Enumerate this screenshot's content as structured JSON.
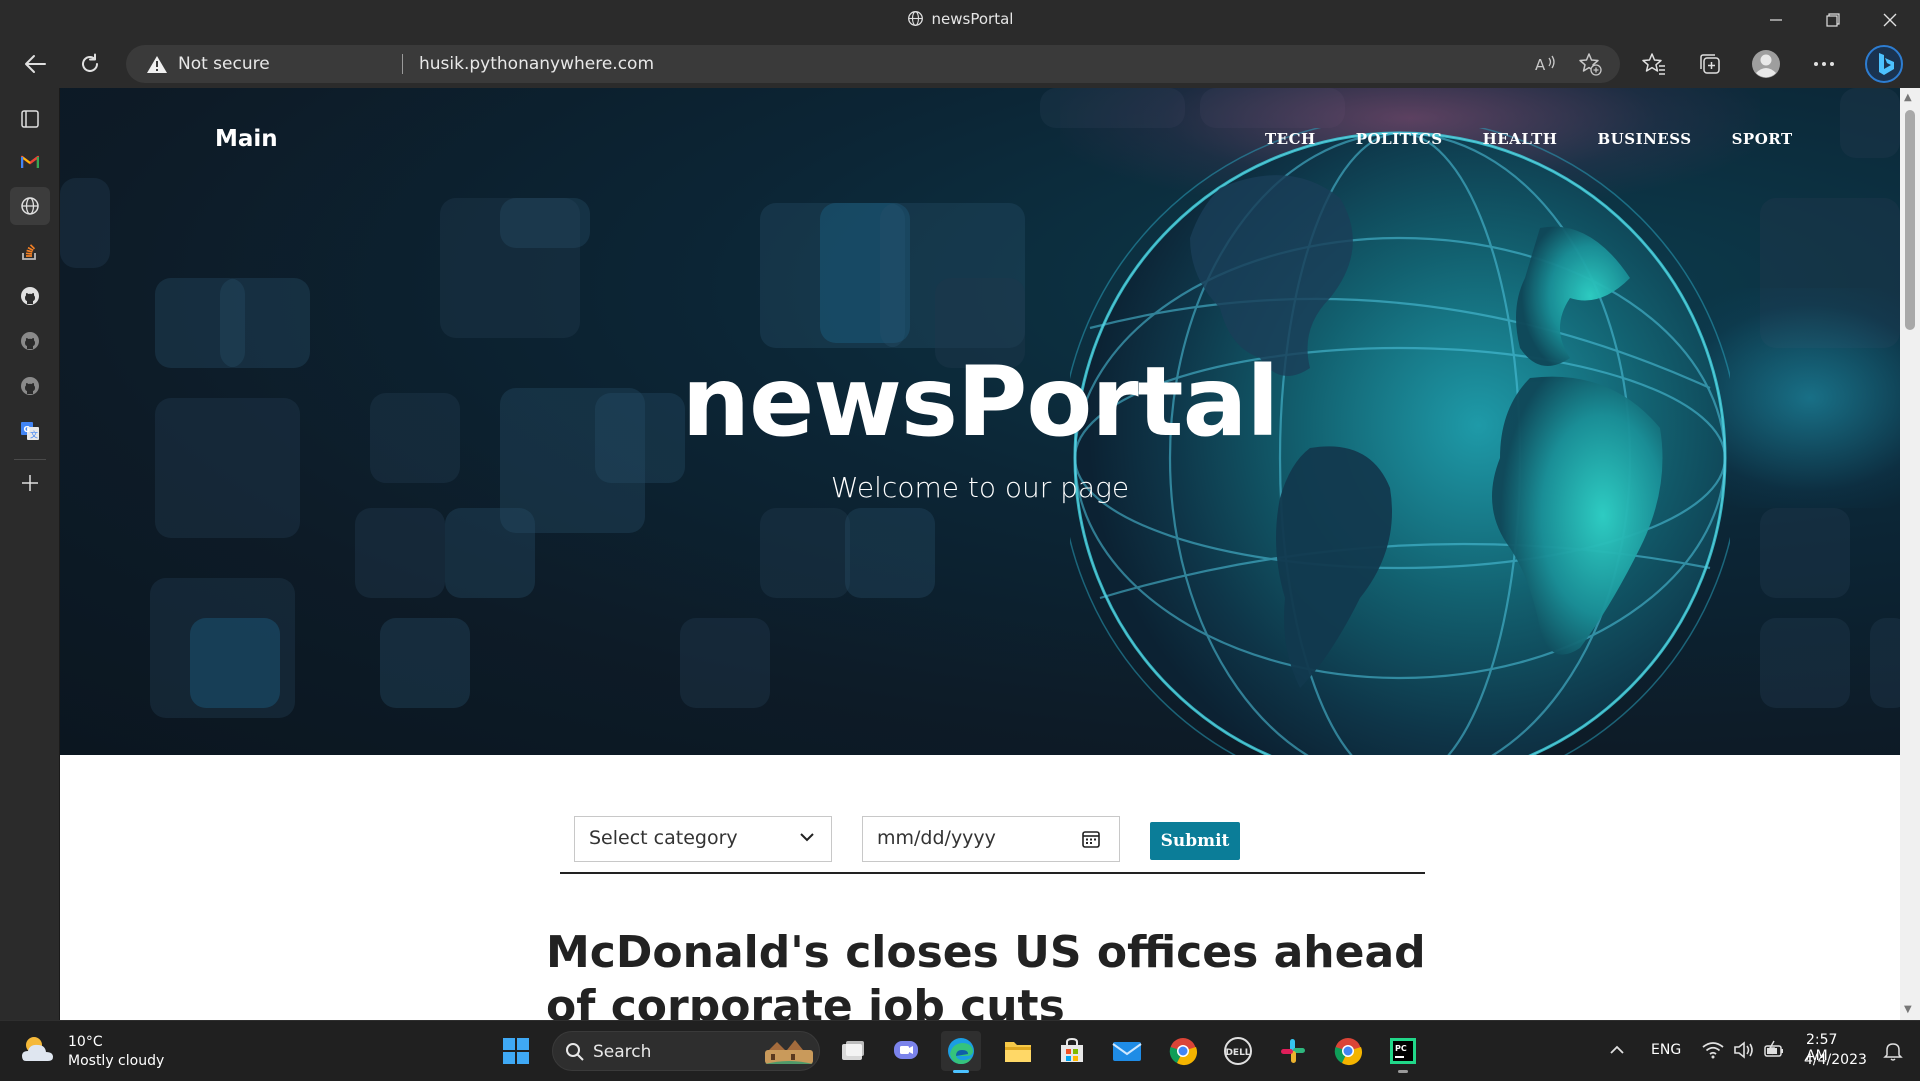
{
  "window": {
    "title": "newsPortal"
  },
  "addressbar": {
    "security_label": "Not secure",
    "url": "husik.pythonanywhere.com"
  },
  "site": {
    "brand": "Main",
    "nav": [
      "TECH",
      "POLITICS",
      "HEALTH",
      "BUSINESS",
      "SPORT"
    ],
    "hero_title": "newsPortal",
    "hero_subtitle": "Welcome to our page",
    "filter": {
      "category_selected": "Select category",
      "date_placeholder": "mm/dd/yyyy",
      "submit_label": "Submit"
    },
    "headline": "McDonald's closes US offices ahead of corporate job cuts"
  },
  "taskbar": {
    "weather_temp": "10°C",
    "weather_desc": "Mostly cloudy",
    "search_label": "Search",
    "language": "ENG",
    "time": "2:57 AM",
    "date": "4/4/2023"
  },
  "colors": {
    "accent_button": "#0b7d98",
    "hero_bg": "#0d1b27",
    "edge_blue": "#4cc2ff"
  }
}
